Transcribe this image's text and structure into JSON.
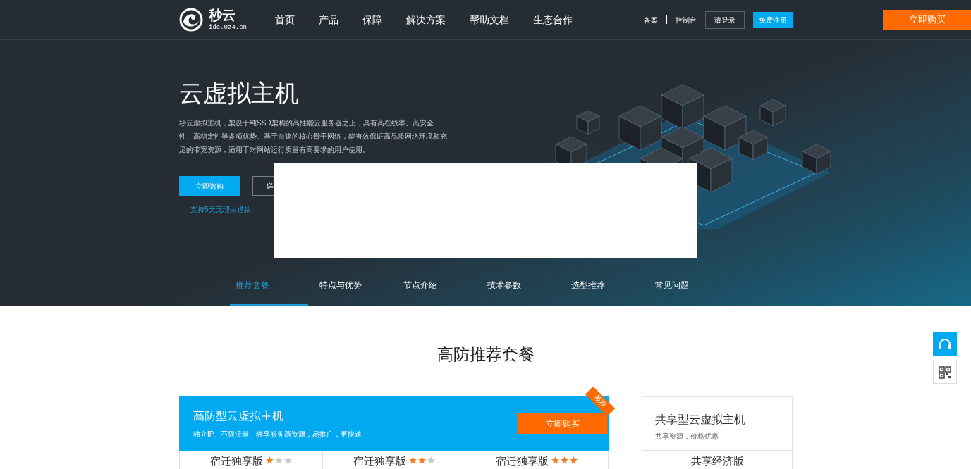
{
  "header": {
    "logo": {
      "name": "秒云",
      "domain": "idc.0z4.cn"
    },
    "nav": [
      {
        "label": "首页"
      },
      {
        "label": "产品"
      },
      {
        "label": "保障"
      },
      {
        "label": "解决方案"
      },
      {
        "label": "帮助文档"
      },
      {
        "label": "生态合作"
      }
    ],
    "links": [
      "备案",
      "控制台"
    ],
    "login": "请登录",
    "register": "免费注册",
    "buy": "立即购买"
  },
  "hero": {
    "title": "云虚拟主机",
    "description": "秒云虚拟主机，架设于纯SSD架构的高性能云服务器之上，具有高在线率、高安全性、高稳定性等多项优势。基于自建的核心骨干网络，能有效保证高品质网络环境和充足的带宽资源，适用于对网站运行质量有高要求的用户使用。",
    "primary_button": "立即选购",
    "secondary_button": "详",
    "refund_note": "支持5天无理由退款"
  },
  "tabs": [
    {
      "label": "推荐套餐",
      "selected": true
    },
    {
      "label": "特点与优势",
      "selected": false
    },
    {
      "label": "节点介绍",
      "selected": false
    },
    {
      "label": "技术参数",
      "selected": false
    },
    {
      "label": "选型推荐",
      "selected": false
    },
    {
      "label": "常见问题",
      "selected": false
    }
  ],
  "section": {
    "title": "高防推荐套餐",
    "main_card": {
      "title": "高防型云虚拟主机",
      "subtitle": "独立IP、不限流量、独享服务器资源，易推广，更快速",
      "buy": "立即购买",
      "ribbon": "推荐",
      "plans": [
        {
          "name": "宿迁独享版",
          "stars": 1
        },
        {
          "name": "宿迁独享版",
          "stars": 2
        },
        {
          "name": "宿迁独享版",
          "stars": 3
        }
      ]
    },
    "side_card": {
      "title": "共享型云虚拟主机",
      "subtitle": "共享资源，价格优惠",
      "plan": "共享经济版"
    }
  }
}
